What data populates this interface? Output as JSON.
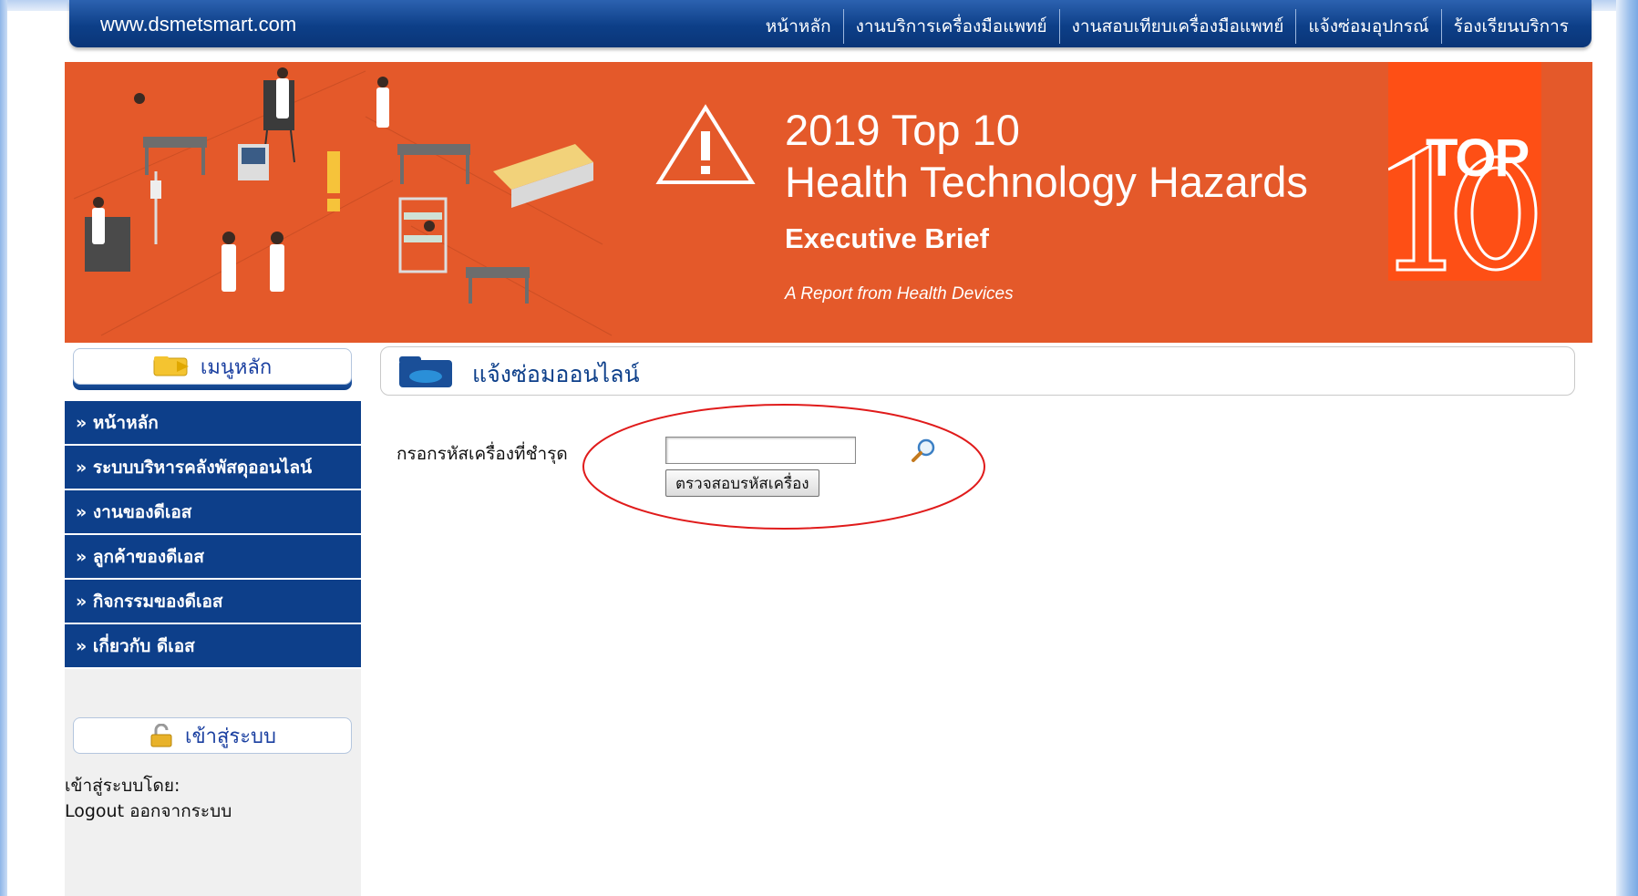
{
  "topbar": {
    "site": "www.dsmetsmart.com",
    "nav": [
      "หน้าหลัก",
      "งานบริการเครื่องมือแพทย์",
      "งานสอบเทียบเครื่องมือแพทย์",
      "แจ้งซ่อมอุปกรณ์",
      "ร้องเรียนบริการ"
    ]
  },
  "banner": {
    "title_line1": "2019 Top 10",
    "title_line2": "Health Technology Hazards",
    "subtitle": "Executive Brief",
    "small": "A Report from Health Devices",
    "badge_top": "TOP",
    "badge_num": "10",
    "colors": {
      "bg": "#e4592a",
      "badge": "#fe4f15"
    }
  },
  "sidebar": {
    "heading": "เมนูหลัก",
    "items": [
      "» หน้าหลัก",
      "» ระบบบริหารคลังพัสดุออนไลน์",
      "» งานของดีเอส",
      "» ลูกค้าของดีเอส",
      "» กิจกรรมของดีเอส",
      "» เกี่ยวกับ ดีเอส"
    ],
    "login_heading": "เข้าสู่ระบบ",
    "login_by": "เข้าสู่ระบบโดย:",
    "logout": "Logout ออกจากระบบ"
  },
  "main": {
    "title": "แจ้งซ่อมออนไลน์",
    "field_label": "กรอกรหัสเครื่องที่ชำรุด",
    "input_value": "",
    "check_button": "ตรวจสอบรหัสเครื่อง",
    "accent": "#0d3f8a"
  },
  "icons": [
    "magnifier-icon",
    "folder-icon",
    "padlock-icon",
    "warning-triangle-icon"
  ]
}
